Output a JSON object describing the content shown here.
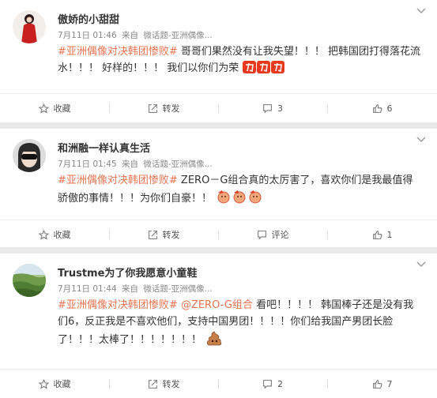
{
  "posts": [
    {
      "name": "傲娇的小甜甜",
      "time": "7月11日 01:46",
      "source_prefix": "来自",
      "source": "微话题-亚洲偶像...",
      "hashtag": "#亚洲偶像对决韩团惨败#",
      "body": " 哥哥们果然没有让我失望！！！ 把韩国团打得落花流水！！！ 好样的！！！ 我们以你们为荣",
      "actions": {
        "favorite": "收藏",
        "repost": "转发",
        "comment": "3",
        "like": "6"
      }
    },
    {
      "name": "和洲融一样认真生活",
      "time": "7月11日 01:45",
      "source_prefix": "来自",
      "source": "微话题-亚洲偶像...",
      "hashtag": "#亚洲偶像对决韩团惨败#",
      "body": " ZERO－G组合真的太厉害了，喜欢你们是我最值得骄傲的事情！！！为你们自豪！！",
      "actions": {
        "favorite": "收藏",
        "repost": "转发",
        "comment": "评论",
        "like": "1"
      }
    },
    {
      "name": "Trustme为了你我愿意小童鞋",
      "time": "7月11日 01:44",
      "source_prefix": "来自",
      "source": "微话题-亚洲偶像...",
      "hashtag": "#亚洲偶像对决韩团惨败#",
      "mention": "@ZERO-G组合",
      "body": " 看吧！！！！ 韩国棒子还是没有我们6，反正我是不喜欢他们，支持中国男团！！！！你们给我国产男团长脸了！！！太棒了！！！！！！！",
      "actions": {
        "favorite": "收藏",
        "repost": "转发",
        "comment": "2",
        "like": "7"
      }
    }
  ],
  "colors": {
    "topic": "#eb7350",
    "background": "#e9e9e9"
  }
}
